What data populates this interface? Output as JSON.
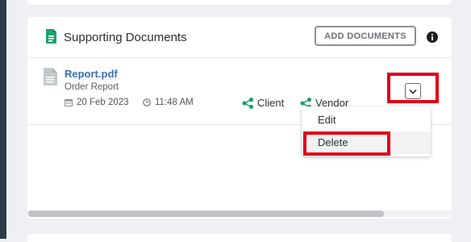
{
  "colors": {
    "accent_green": "#1aa36f",
    "link_blue": "#3a6fb0",
    "highlight_red": "#e1001a"
  },
  "header": {
    "title": "Supporting Documents",
    "add_button_label": "ADD DOCUMENTS",
    "doc_icon": "document-icon",
    "info_icon": "info-icon"
  },
  "document": {
    "file_name": "Report.pdf",
    "description": "Order Report",
    "date": "20 Feb 2023",
    "time": "11:48 AM",
    "shares": [
      "Client",
      "Vendor"
    ],
    "file_icon": "file-icon"
  },
  "menu": {
    "items": [
      "Edit",
      "Delete"
    ]
  }
}
